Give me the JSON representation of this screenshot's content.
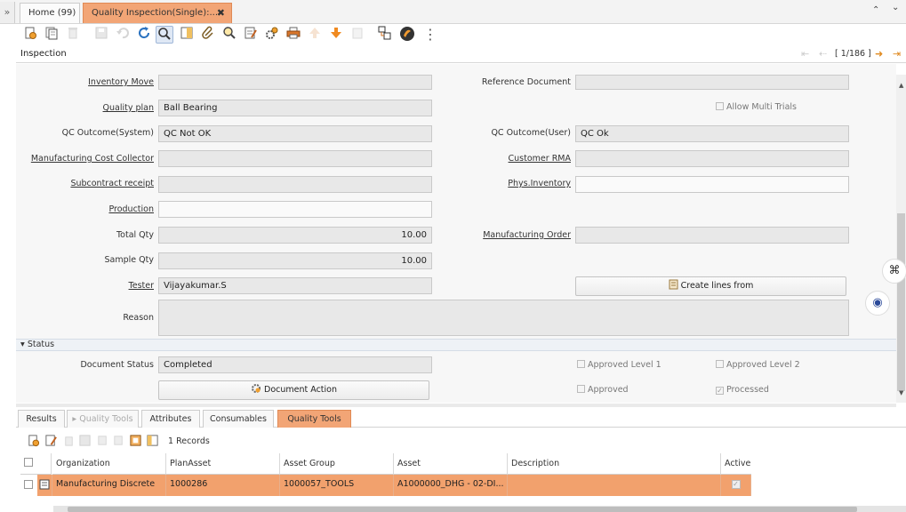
{
  "tabs": [
    {
      "label": "Home (99)"
    },
    {
      "label": "Quality Inspection(Single):..."
    }
  ],
  "tab_close": "✖",
  "tab_controls": {
    "collapse": "⌃",
    "menu": "⌄"
  },
  "toolbar": {
    "icons": [
      "new-record-icon",
      "copy-record-icon",
      "delete-icon",
      "save-icon",
      "undo-icon",
      "refresh-icon",
      "find-icon",
      "grid-toggle-icon",
      "attachment-icon",
      "zoom-across-icon",
      "notes-icon",
      "print-icon",
      "process-icon",
      "parent-record-icon",
      "detail-record-icon",
      "report-icon",
      "workflow-icon",
      "archive-icon",
      "more-menu-icon"
    ]
  },
  "header": {
    "title": "Inspection",
    "record_indicator": "[ 1/186 ]"
  },
  "form": {
    "inventory_move": {
      "label": "Inventory Move",
      "value": ""
    },
    "reference_document": {
      "label": "Reference Document",
      "value": ""
    },
    "quality_plan": {
      "label": "Quality plan",
      "value": "Ball Bearing"
    },
    "allow_multi_trials": {
      "label": "Allow Multi Trials",
      "checked": false
    },
    "qc_outcome_system": {
      "label": "QC Outcome(System)",
      "value": "QC Not OK"
    },
    "qc_outcome_user": {
      "label": "QC Outcome(User)",
      "value": "QC Ok"
    },
    "manufacturing_cost_collector": {
      "label": "Manufacturing Cost Collector",
      "value": ""
    },
    "customer_rma": {
      "label": "Customer RMA",
      "value": ""
    },
    "subcontract_receipt": {
      "label": "Subcontract receipt",
      "value": ""
    },
    "phys_inventory": {
      "label": "Phys.Inventory",
      "value": ""
    },
    "production": {
      "label": "Production",
      "value": ""
    },
    "total_qty": {
      "label": "Total Qty",
      "value": "10.00"
    },
    "manufacturing_order": {
      "label": "Manufacturing Order",
      "value": ""
    },
    "sample_qty": {
      "label": "Sample Qty",
      "value": "10.00"
    },
    "tester": {
      "label": "Tester",
      "value": "Vijayakumar.S"
    },
    "create_lines_from": {
      "label": "Create lines from"
    },
    "reason": {
      "label": "Reason",
      "value": ""
    }
  },
  "status_section": {
    "title": "Status",
    "document_status": {
      "label": "Document Status",
      "value": "Completed"
    },
    "document_action": {
      "label": "Document Action"
    },
    "approved_level_1": {
      "label": "Approved Level 1",
      "checked": false
    },
    "approved_level_2": {
      "label": "Approved Level 2",
      "checked": false
    },
    "approved": {
      "label": "Approved",
      "checked": false
    },
    "processed": {
      "label": "Processed",
      "checked": true
    }
  },
  "detail_tabs": [
    {
      "label": "Results",
      "state": "normal"
    },
    {
      "label": "Quality Tools",
      "state": "disabled"
    },
    {
      "label": "Attributes",
      "state": "normal"
    },
    {
      "label": "Consumables",
      "state": "normal"
    },
    {
      "label": "Quality Tools",
      "state": "active"
    }
  ],
  "grid": {
    "record_count": "1 Records",
    "columns": [
      "Organization",
      "PlanAsset",
      "Asset Group",
      "Asset",
      "Description",
      "Active"
    ],
    "rows": [
      {
        "organization": "Manufacturing Discrete",
        "plan_asset": "1000286",
        "asset_group": "1000057_TOOLS",
        "asset": "A1000000_DHG - 02-DI...",
        "description": "",
        "active": true
      }
    ]
  },
  "colors": {
    "accent": "#f2a576",
    "row_selected": "#f2a16d"
  }
}
